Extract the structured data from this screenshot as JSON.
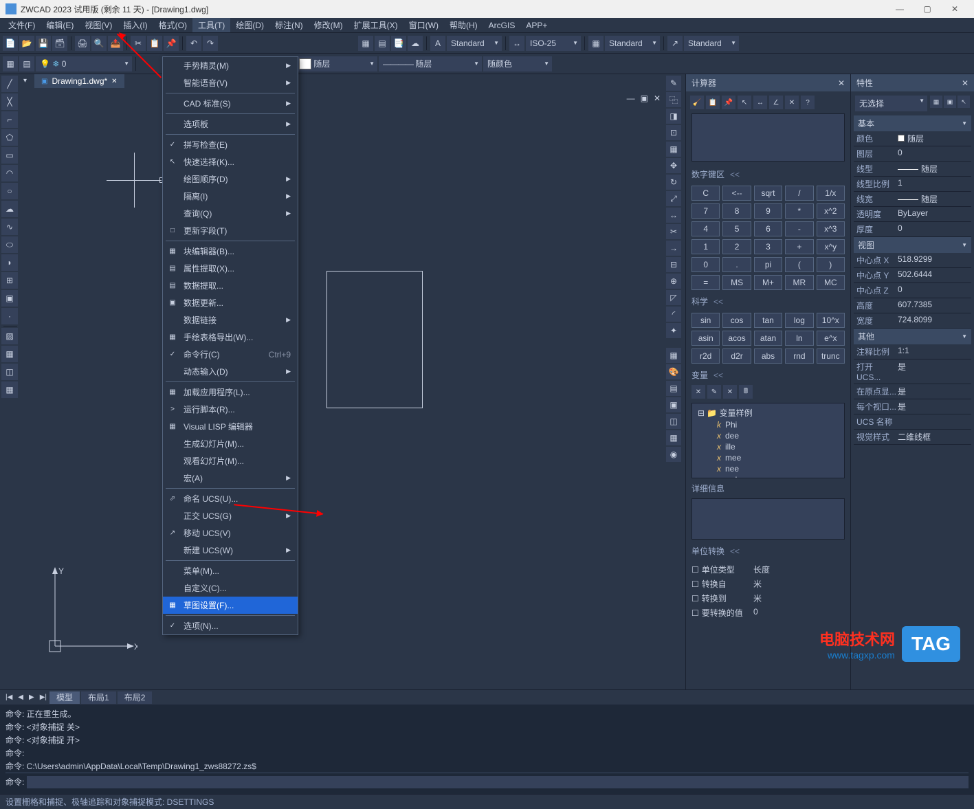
{
  "titlebar": {
    "title": "ZWCAD 2023 试用版 (剩余 11 天) - [Drawing1.dwg]",
    "min": "—",
    "max": "▢",
    "close": "✕"
  },
  "menubar": [
    "文件(F)",
    "编辑(E)",
    "视图(V)",
    "插入(I)",
    "格式(O)",
    "工具(T)",
    "绘图(D)",
    "标注(N)",
    "修改(M)",
    "扩展工具(X)",
    "窗口(W)",
    "帮助(H)",
    "ArcGIS",
    "APP+"
  ],
  "active_menu_index": 5,
  "toolbar2": {
    "text_standard": "Standard",
    "dim_iso": "ISO-25",
    "table_standard": "Standard",
    "mleader_standard": "Standard"
  },
  "layerbar": {
    "layer": "0",
    "color": "随层",
    "linetype": "随层",
    "lineweight": "随颜色"
  },
  "doc_tab": {
    "name": "Drawing1.dwg*",
    "close": "✕"
  },
  "canvas_controls": {
    "min": "—",
    "max": "▣",
    "close": "✕"
  },
  "axes": {
    "y": "Y",
    "x": "X"
  },
  "ctx_menu": [
    {
      "type": "item",
      "label": "手势精灵(M)",
      "arrow": true
    },
    {
      "type": "item",
      "label": "智能语音(V)",
      "arrow": true
    },
    {
      "type": "sep"
    },
    {
      "type": "item",
      "label": "CAD 标准(S)",
      "arrow": true
    },
    {
      "type": "sep"
    },
    {
      "type": "item",
      "label": "选项板",
      "arrow": true
    },
    {
      "type": "sep"
    },
    {
      "type": "item",
      "label": "拼写检查(E)",
      "icon": "✓"
    },
    {
      "type": "item",
      "label": "快速选择(K)...",
      "icon": "↖"
    },
    {
      "type": "item",
      "label": "绘图顺序(D)",
      "arrow": true
    },
    {
      "type": "item",
      "label": "隔离(I)",
      "arrow": true
    },
    {
      "type": "item",
      "label": "查询(Q)",
      "arrow": true
    },
    {
      "type": "item",
      "label": "更新字段(T)",
      "icon": "□"
    },
    {
      "type": "sep"
    },
    {
      "type": "item",
      "label": "块编辑器(B)...",
      "icon": "▦"
    },
    {
      "type": "item",
      "label": "属性提取(X)...",
      "icon": "▤"
    },
    {
      "type": "item",
      "label": "数据提取...",
      "icon": "▤"
    },
    {
      "type": "item",
      "label": "数据更新...",
      "icon": "▣"
    },
    {
      "type": "item",
      "label": "数据链接",
      "arrow": true
    },
    {
      "type": "item",
      "label": "手绘表格导出(W)...",
      "icon": "▦"
    },
    {
      "type": "item",
      "label": "命令行(C)",
      "hotkey": "Ctrl+9",
      "icon": "✓"
    },
    {
      "type": "item",
      "label": "动态输入(D)",
      "arrow": true
    },
    {
      "type": "sep"
    },
    {
      "type": "item",
      "label": "加载应用程序(L)...",
      "icon": "▦"
    },
    {
      "type": "item",
      "label": "运行脚本(R)...",
      "icon": ">"
    },
    {
      "type": "item",
      "label": "Visual LISP 编辑器",
      "icon": "▦"
    },
    {
      "type": "item",
      "label": "生成幻灯片(M)...",
      "icon": ""
    },
    {
      "type": "item",
      "label": "观看幻灯片(M)...",
      "icon": ""
    },
    {
      "type": "item",
      "label": "宏(A)",
      "arrow": true
    },
    {
      "type": "sep"
    },
    {
      "type": "item",
      "label": "命名 UCS(U)...",
      "icon": "⬀"
    },
    {
      "type": "item",
      "label": "正交 UCS(G)",
      "arrow": true
    },
    {
      "type": "item",
      "label": "移动 UCS(V)",
      "icon": "↗"
    },
    {
      "type": "item",
      "label": "新建 UCS(W)",
      "arrow": true
    },
    {
      "type": "sep"
    },
    {
      "type": "item",
      "label": "菜单(M)...",
      "icon": ""
    },
    {
      "type": "item",
      "label": "自定义(C)...",
      "icon": ""
    },
    {
      "type": "item",
      "label": "草图设置(F)...",
      "icon": "▦",
      "highlight": true
    },
    {
      "type": "sep"
    },
    {
      "type": "item",
      "label": "选项(N)...",
      "icon": "✓"
    }
  ],
  "bottom_tabs": {
    "tabs": [
      "模型",
      "布局1",
      "布局2"
    ],
    "active": 0
  },
  "command_log": [
    "命令: 正在重生成。",
    "命令: <对象捕捉 关>",
    "命令: <对象捕捉 开>",
    "命令:",
    "命令: C:\\Users\\admin\\AppData\\Local\\Temp\\Drawing1_zws88272.zs$"
  ],
  "cmd_prompt": "命令:",
  "status_text": "设置栅格和捕捉、极轴追踪和对象捕捉模式: DSETTINGS",
  "calc": {
    "title": "计算器",
    "sections": {
      "keypad": "数字键区",
      "scientific": "科学",
      "variables": "变量",
      "detail": "详细信息",
      "unit": "单位转换"
    },
    "keypad": [
      [
        "C",
        "<--",
        "sqrt",
        "/",
        "1/x"
      ],
      [
        "7",
        "8",
        "9",
        "*",
        "x^2"
      ],
      [
        "4",
        "5",
        "6",
        "-",
        "x^3"
      ],
      [
        "1",
        "2",
        "3",
        "+",
        "x^y"
      ],
      [
        "0",
        ".",
        "pi",
        "(",
        ")"
      ],
      [
        "=",
        "MS",
        "M+",
        "MR",
        "MC"
      ]
    ],
    "scientific": [
      [
        "sin",
        "cos",
        "tan",
        "log",
        "10^x"
      ],
      [
        "asin",
        "acos",
        "atan",
        "ln",
        "e^x"
      ],
      [
        "r2d",
        "d2r",
        "abs",
        "rnd",
        "trunc"
      ]
    ],
    "vars_root": "变量样例",
    "vars": [
      "Phi",
      "dee",
      "ille",
      "mee",
      "nee",
      "rad"
    ],
    "unit_rows": [
      {
        "label": "单位类型",
        "value": "长度"
      },
      {
        "label": "转换自",
        "value": "米"
      },
      {
        "label": "转换到",
        "value": "米"
      },
      {
        "label": "要转换的值",
        "value": "0"
      }
    ]
  },
  "props": {
    "title": "特性",
    "selector": "无选择",
    "groups": [
      {
        "name": "基本",
        "rows": [
          {
            "label": "颜色",
            "value": "随层",
            "swatch": true
          },
          {
            "label": "图层",
            "value": "0"
          },
          {
            "label": "线型",
            "value": "随层",
            "line": true
          },
          {
            "label": "线型比例",
            "value": "1"
          },
          {
            "label": "线宽",
            "value": "随层",
            "line": true
          },
          {
            "label": "透明度",
            "value": "ByLayer"
          },
          {
            "label": "厚度",
            "value": "0"
          }
        ]
      },
      {
        "name": "视图",
        "rows": [
          {
            "label": "中心点 X",
            "value": "518.9299"
          },
          {
            "label": "中心点 Y",
            "value": "502.6444"
          },
          {
            "label": "中心点 Z",
            "value": "0"
          },
          {
            "label": "高度",
            "value": "607.7385"
          },
          {
            "label": "宽度",
            "value": "724.8099"
          }
        ]
      },
      {
        "name": "其他",
        "rows": [
          {
            "label": "注释比例",
            "value": "1:1"
          },
          {
            "label": "打开 UCS...",
            "value": "是"
          },
          {
            "label": "在原点显...",
            "value": "是"
          },
          {
            "label": "每个视口...",
            "value": "是"
          },
          {
            "label": "UCS 名称",
            "value": ""
          },
          {
            "label": "视觉样式",
            "value": "二维线框"
          }
        ]
      }
    ]
  },
  "watermark": {
    "red": "电脑技术网",
    "blue": "www.tagxp.com",
    "tag": "TAG"
  }
}
